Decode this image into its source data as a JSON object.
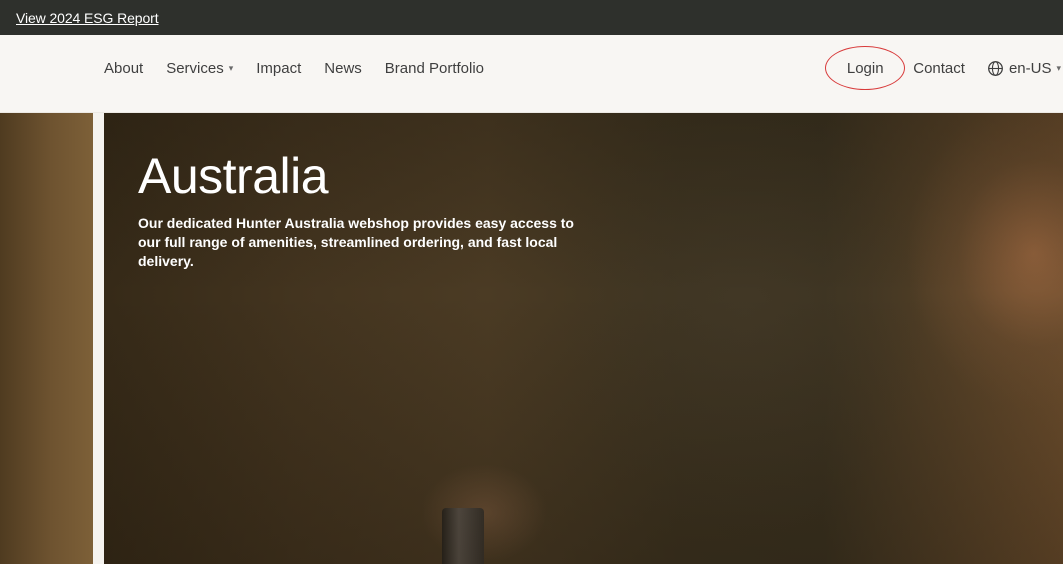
{
  "banner": {
    "link_label": "View 2024 ESG Report"
  },
  "nav": {
    "items": [
      {
        "label": "About"
      },
      {
        "label": "Services",
        "has_dropdown": true
      },
      {
        "label": "Impact"
      },
      {
        "label": "News"
      },
      {
        "label": "Brand Portfolio"
      }
    ],
    "login_label": "Login",
    "contact_label": "Contact",
    "language_label": "en-US"
  },
  "hero": {
    "title": "Australia",
    "description": "Our dedicated Hunter Australia webshop provides easy access to our full range of amenities, streamlined ordering, and fast local delivery."
  },
  "icons": {
    "dropdown": "chevron-down-icon",
    "language": "globe-icon"
  },
  "colors": {
    "topbar_bg": "#2e302c",
    "nav_bg": "#f8f6f3",
    "login_highlight": "#d83a3a"
  }
}
